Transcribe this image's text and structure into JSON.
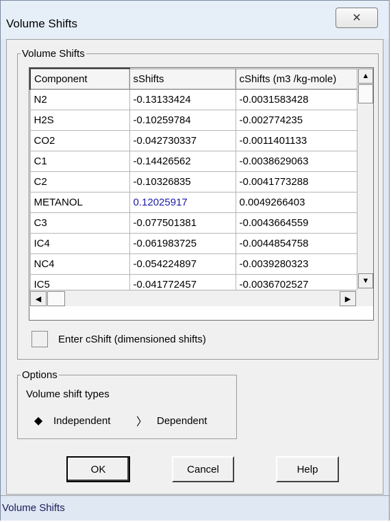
{
  "window": {
    "title": "Volume Shifts",
    "close_glyph": "✕",
    "status": "Volume Shifts"
  },
  "volume_shifts_group": {
    "legend": "Volume Shifts",
    "columns": [
      "Component",
      "sShifts",
      "cShifts (m3 /kg-mole)"
    ],
    "rows": [
      [
        "N2",
        "-0.13133424",
        "-0.0031583428"
      ],
      [
        "H2S",
        "-0.10259784",
        "-0.002774235"
      ],
      [
        "CO2",
        "-0.042730337",
        "-0.0011401133"
      ],
      [
        "C1",
        "-0.14426562",
        "-0.0038629063"
      ],
      [
        "C2",
        "-0.10326835",
        "-0.0041773288"
      ],
      [
        "METANOL",
        "0.12025917",
        "0.0049266403"
      ],
      [
        "C3",
        "-0.077501381",
        "-0.0043664559"
      ],
      [
        "IC4",
        "-0.061983725",
        "-0.0044854758"
      ],
      [
        "NC4",
        "-0.054224897",
        "-0.0039280323"
      ],
      [
        "IC5",
        "-0.041772457",
        "-0.0036702527"
      ]
    ],
    "highlight_color": "#1a1aa8",
    "checkbox_label": "Enter cShift (dimensioned shifts)",
    "checkbox_checked": false
  },
  "options_group": {
    "legend": "Options",
    "label": "Volume shift types",
    "radio_independent": "Independent",
    "radio_dependent": "Dependent",
    "selected": "Independent"
  },
  "buttons": {
    "ok": "OK",
    "cancel": "Cancel",
    "help": "Help"
  },
  "icons": {
    "scroll_up": "▲",
    "scroll_down": "▼",
    "scroll_left": "◀",
    "scroll_right": "▶",
    "radio_selected": "◆",
    "radio_unselected": "〉"
  }
}
